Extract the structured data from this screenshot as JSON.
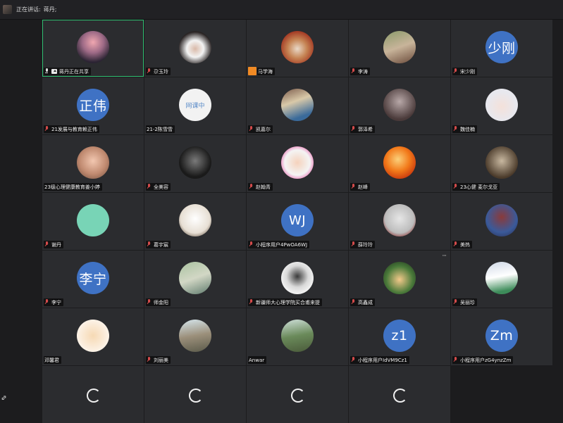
{
  "topbar": {
    "speaking_label": "正在讲话:",
    "speaking_name": "蒋丹;"
  },
  "participants": [
    {
      "name": "蒋丹正在共享",
      "avatar": "photo",
      "mic": "on",
      "sharing": true,
      "active": true
    },
    {
      "name": "尕玉玲",
      "avatar": "photo",
      "mic": "muted"
    },
    {
      "name": "马学海",
      "avatar": "photo",
      "mic": "none",
      "hand_badge": true
    },
    {
      "name": "李涛",
      "avatar": "photo",
      "mic": "muted"
    },
    {
      "name": "宋少刚",
      "avatar": "text",
      "avatar_text": "少刚",
      "mic": "muted"
    },
    {
      "name": "21发展与教育赖正伟",
      "avatar": "text",
      "avatar_text": "正伟",
      "mic": "muted"
    },
    {
      "name": "21-2陈雪雪",
      "avatar": "logo",
      "avatar_text": "网课中",
      "mic": "none"
    },
    {
      "name": "凯嘉尔",
      "avatar": "photo",
      "mic": "muted"
    },
    {
      "name": "郭泽希",
      "avatar": "photo",
      "mic": "muted"
    },
    {
      "name": "魏佳楠",
      "avatar": "photo",
      "mic": "muted"
    },
    {
      "name": "23级心理健康教育姜小婷",
      "avatar": "photo",
      "mic": "none"
    },
    {
      "name": "全美容",
      "avatar": "photo",
      "mic": "muted"
    },
    {
      "name": "赵翰青",
      "avatar": "photo",
      "mic": "muted"
    },
    {
      "name": "赵峰",
      "avatar": "photo",
      "mic": "muted"
    },
    {
      "name": "23心健 麦尔戈亚",
      "avatar": "photo",
      "mic": "muted"
    },
    {
      "name": "谢丹",
      "avatar": "photo",
      "mic": "muted"
    },
    {
      "name": "葛宇宸",
      "avatar": "photo",
      "mic": "muted"
    },
    {
      "name": "小程序用户4PwOA6WJ",
      "avatar": "text",
      "avatar_text": "WJ",
      "mic": "muted"
    },
    {
      "name": "薛玲玲",
      "avatar": "photo",
      "mic": "muted"
    },
    {
      "name": "美热",
      "avatar": "photo",
      "mic": "muted"
    },
    {
      "name": "李宁",
      "avatar": "text",
      "avatar_text": "李宁",
      "mic": "muted"
    },
    {
      "name": "师金阳",
      "avatar": "photo",
      "mic": "muted"
    },
    {
      "name": "新疆师大心理学院买合甫来提",
      "avatar": "photo",
      "mic": "muted"
    },
    {
      "name": "高鑫成",
      "avatar": "photo",
      "mic": "muted",
      "more": "···"
    },
    {
      "name": "吴丽珍",
      "avatar": "photo",
      "mic": "muted"
    },
    {
      "name": "邓馨君",
      "avatar": "photo",
      "mic": "none"
    },
    {
      "name": "刘丽美",
      "avatar": "photo",
      "mic": "muted"
    },
    {
      "name": "Anwar",
      "avatar": "photo",
      "mic": "none"
    },
    {
      "name": "小程序用户IdVM9Cz1",
      "avatar": "text",
      "avatar_text": "z1",
      "mic": "muted"
    },
    {
      "name": "小程序用户zG4ynzZm",
      "avatar": "text",
      "avatar_text": "Zm",
      "mic": "muted"
    }
  ],
  "loading_tiles": 4,
  "colors": {
    "active_border": "#2fbf71",
    "text_avatar_bg": "#3f72c4",
    "tile_bg": "#2b2c2f",
    "hand_badge": "#f08a24"
  },
  "icons": {
    "mic": "microphone-icon",
    "muted": "microphone-muted-icon",
    "share": "screen-share-icon",
    "loading": "loading-spinner-icon"
  }
}
